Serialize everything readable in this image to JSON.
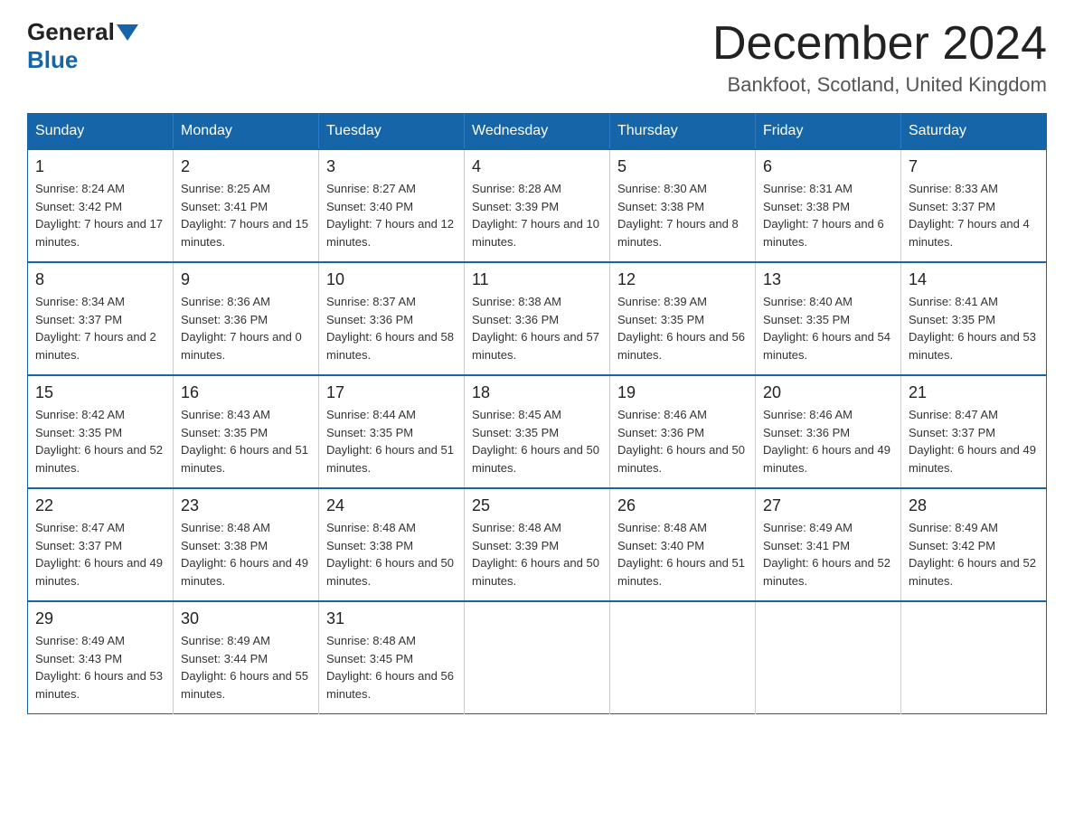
{
  "header": {
    "logo_general": "General",
    "logo_blue": "Blue",
    "month_title": "December 2024",
    "location": "Bankfoot, Scotland, United Kingdom"
  },
  "weekdays": [
    "Sunday",
    "Monday",
    "Tuesday",
    "Wednesday",
    "Thursday",
    "Friday",
    "Saturday"
  ],
  "weeks": [
    [
      {
        "day": "1",
        "sunrise": "8:24 AM",
        "sunset": "3:42 PM",
        "daylight": "7 hours and 17 minutes."
      },
      {
        "day": "2",
        "sunrise": "8:25 AM",
        "sunset": "3:41 PM",
        "daylight": "7 hours and 15 minutes."
      },
      {
        "day": "3",
        "sunrise": "8:27 AM",
        "sunset": "3:40 PM",
        "daylight": "7 hours and 12 minutes."
      },
      {
        "day": "4",
        "sunrise": "8:28 AM",
        "sunset": "3:39 PM",
        "daylight": "7 hours and 10 minutes."
      },
      {
        "day": "5",
        "sunrise": "8:30 AM",
        "sunset": "3:38 PM",
        "daylight": "7 hours and 8 minutes."
      },
      {
        "day": "6",
        "sunrise": "8:31 AM",
        "sunset": "3:38 PM",
        "daylight": "7 hours and 6 minutes."
      },
      {
        "day": "7",
        "sunrise": "8:33 AM",
        "sunset": "3:37 PM",
        "daylight": "7 hours and 4 minutes."
      }
    ],
    [
      {
        "day": "8",
        "sunrise": "8:34 AM",
        "sunset": "3:37 PM",
        "daylight": "7 hours and 2 minutes."
      },
      {
        "day": "9",
        "sunrise": "8:36 AM",
        "sunset": "3:36 PM",
        "daylight": "7 hours and 0 minutes."
      },
      {
        "day": "10",
        "sunrise": "8:37 AM",
        "sunset": "3:36 PM",
        "daylight": "6 hours and 58 minutes."
      },
      {
        "day": "11",
        "sunrise": "8:38 AM",
        "sunset": "3:36 PM",
        "daylight": "6 hours and 57 minutes."
      },
      {
        "day": "12",
        "sunrise": "8:39 AM",
        "sunset": "3:35 PM",
        "daylight": "6 hours and 56 minutes."
      },
      {
        "day": "13",
        "sunrise": "8:40 AM",
        "sunset": "3:35 PM",
        "daylight": "6 hours and 54 minutes."
      },
      {
        "day": "14",
        "sunrise": "8:41 AM",
        "sunset": "3:35 PM",
        "daylight": "6 hours and 53 minutes."
      }
    ],
    [
      {
        "day": "15",
        "sunrise": "8:42 AM",
        "sunset": "3:35 PM",
        "daylight": "6 hours and 52 minutes."
      },
      {
        "day": "16",
        "sunrise": "8:43 AM",
        "sunset": "3:35 PM",
        "daylight": "6 hours and 51 minutes."
      },
      {
        "day": "17",
        "sunrise": "8:44 AM",
        "sunset": "3:35 PM",
        "daylight": "6 hours and 51 minutes."
      },
      {
        "day": "18",
        "sunrise": "8:45 AM",
        "sunset": "3:35 PM",
        "daylight": "6 hours and 50 minutes."
      },
      {
        "day": "19",
        "sunrise": "8:46 AM",
        "sunset": "3:36 PM",
        "daylight": "6 hours and 50 minutes."
      },
      {
        "day": "20",
        "sunrise": "8:46 AM",
        "sunset": "3:36 PM",
        "daylight": "6 hours and 49 minutes."
      },
      {
        "day": "21",
        "sunrise": "8:47 AM",
        "sunset": "3:37 PM",
        "daylight": "6 hours and 49 minutes."
      }
    ],
    [
      {
        "day": "22",
        "sunrise": "8:47 AM",
        "sunset": "3:37 PM",
        "daylight": "6 hours and 49 minutes."
      },
      {
        "day": "23",
        "sunrise": "8:48 AM",
        "sunset": "3:38 PM",
        "daylight": "6 hours and 49 minutes."
      },
      {
        "day": "24",
        "sunrise": "8:48 AM",
        "sunset": "3:38 PM",
        "daylight": "6 hours and 50 minutes."
      },
      {
        "day": "25",
        "sunrise": "8:48 AM",
        "sunset": "3:39 PM",
        "daylight": "6 hours and 50 minutes."
      },
      {
        "day": "26",
        "sunrise": "8:48 AM",
        "sunset": "3:40 PM",
        "daylight": "6 hours and 51 minutes."
      },
      {
        "day": "27",
        "sunrise": "8:49 AM",
        "sunset": "3:41 PM",
        "daylight": "6 hours and 52 minutes."
      },
      {
        "day": "28",
        "sunrise": "8:49 AM",
        "sunset": "3:42 PM",
        "daylight": "6 hours and 52 minutes."
      }
    ],
    [
      {
        "day": "29",
        "sunrise": "8:49 AM",
        "sunset": "3:43 PM",
        "daylight": "6 hours and 53 minutes."
      },
      {
        "day": "30",
        "sunrise": "8:49 AM",
        "sunset": "3:44 PM",
        "daylight": "6 hours and 55 minutes."
      },
      {
        "day": "31",
        "sunrise": "8:48 AM",
        "sunset": "3:45 PM",
        "daylight": "6 hours and 56 minutes."
      },
      null,
      null,
      null,
      null
    ]
  ]
}
